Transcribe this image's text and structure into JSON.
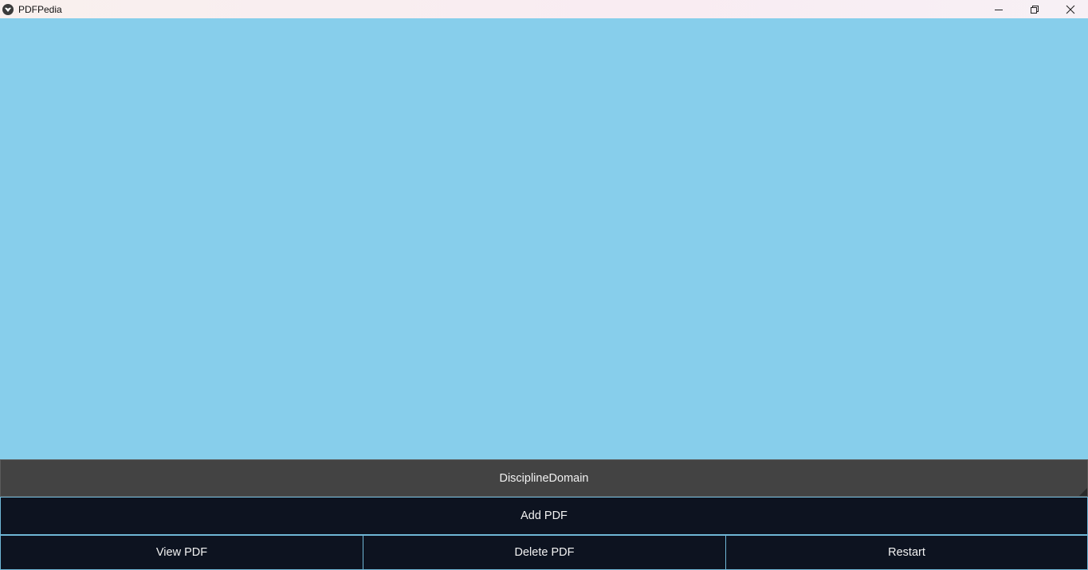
{
  "window": {
    "title": "PDFPedia",
    "icon": "app-logo-icon",
    "controls": [
      "minimize-icon",
      "restore-icon",
      "close-icon"
    ]
  },
  "colors": {
    "content_background": "#87ceeb",
    "dropdown_background": "#434343",
    "button_background": "#0d1320",
    "button_border": "#6fb6d6",
    "text": "#f2f2f2"
  },
  "domain_select": {
    "selected": "DisciplineDomain"
  },
  "actions": {
    "add_label": "Add PDF",
    "view_label": "View PDF",
    "delete_label": "Delete PDF",
    "restart_label": "Restart"
  }
}
